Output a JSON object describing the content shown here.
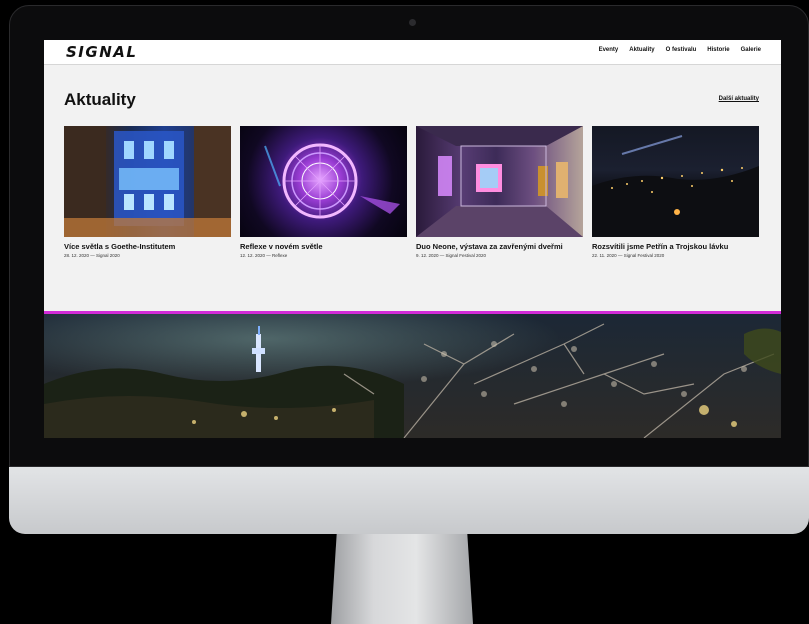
{
  "site": {
    "logo": "SIGNAL",
    "nav": [
      "Eventy",
      "Aktuality",
      "O festivalu",
      "Historie",
      "Galerie"
    ]
  },
  "news": {
    "title": "Aktuality",
    "more_link": "Další aktuality",
    "cards": [
      {
        "title": "Více světla s Goethe-Institutem",
        "meta": "28. 12. 2020 — Signal 2020"
      },
      {
        "title": "Reflexe v novém světle",
        "meta": "12. 12. 2020 — Reflexe"
      },
      {
        "title": "Duo Neone, výstava za zavřenými dveřmi",
        "meta": "9. 12. 2020 — Signal Festival 2020"
      },
      {
        "title": "Rozsvítili jsme Petřín a Trojskou lávku",
        "meta": "22. 11. 2020 — Signal Festival 2020"
      }
    ]
  },
  "colors": {
    "accent": "#d22bd8",
    "page_bg": "#f2f2f2"
  }
}
